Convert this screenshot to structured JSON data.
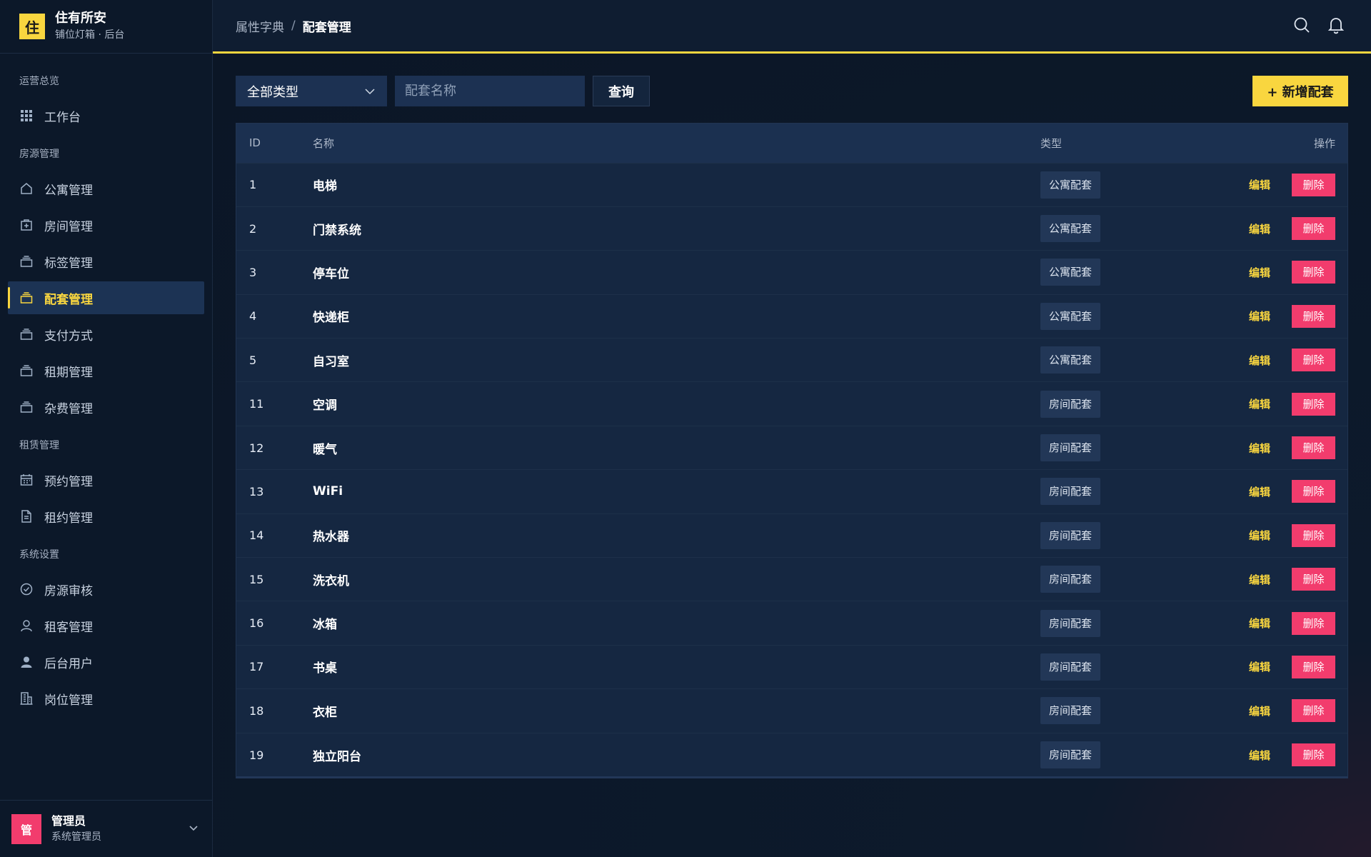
{
  "brand": {
    "logo": "住",
    "title": "住有所安",
    "subtitle": "铺位灯箱 · 后台"
  },
  "colors": {
    "accent": "#f9d63f",
    "danger": "#f23c6d",
    "sidebar_bg": "#0c1829",
    "active_bg": "#1c3354"
  },
  "nav": [
    {
      "title": "运营总览",
      "items": [
        {
          "label": "工作台",
          "icon": "grid-icon"
        }
      ]
    },
    {
      "title": "房源管理",
      "items": [
        {
          "label": "公寓管理",
          "icon": "home-icon"
        },
        {
          "label": "房间管理",
          "icon": "door-icon"
        },
        {
          "label": "标签管理",
          "icon": "layers-icon"
        },
        {
          "label": "配套管理",
          "icon": "layers-icon",
          "active": true
        },
        {
          "label": "支付方式",
          "icon": "layers-icon"
        },
        {
          "label": "租期管理",
          "icon": "layers-icon"
        },
        {
          "label": "杂费管理",
          "icon": "layers-icon"
        }
      ]
    },
    {
      "title": "租赁管理",
      "items": [
        {
          "label": "预约管理",
          "icon": "calendar-icon"
        },
        {
          "label": "租约管理",
          "icon": "document-icon"
        }
      ]
    },
    {
      "title": "系统设置",
      "items": [
        {
          "label": "房源审核",
          "icon": "check-circle-icon"
        },
        {
          "label": "租客管理",
          "icon": "user-icon"
        },
        {
          "label": "后台用户",
          "icon": "user-filled-icon"
        },
        {
          "label": "岗位管理",
          "icon": "building-icon"
        }
      ]
    }
  ],
  "user": {
    "avatar": "管",
    "name": "管理员",
    "role": "系统管理员"
  },
  "breadcrumb": {
    "parent": "属性字典",
    "separator": "/",
    "current": "配套管理"
  },
  "toolbar": {
    "type_select": "全部类型",
    "name_placeholder": "配套名称",
    "query_label": "查询",
    "add_label": "+ 新增配套"
  },
  "table": {
    "headers": {
      "id": "ID",
      "name": "名称",
      "type": "类型",
      "ops": "操作"
    },
    "edit_label": "编辑",
    "delete_label": "删除",
    "rows": [
      {
        "id": "1",
        "name": "电梯",
        "type": "公寓配套"
      },
      {
        "id": "2",
        "name": "门禁系统",
        "type": "公寓配套"
      },
      {
        "id": "3",
        "name": "停车位",
        "type": "公寓配套"
      },
      {
        "id": "4",
        "name": "快递柜",
        "type": "公寓配套"
      },
      {
        "id": "5",
        "name": "自习室",
        "type": "公寓配套"
      },
      {
        "id": "11",
        "name": "空调",
        "type": "房间配套"
      },
      {
        "id": "12",
        "name": "暖气",
        "type": "房间配套"
      },
      {
        "id": "13",
        "name": "WiFi",
        "type": "房间配套"
      },
      {
        "id": "14",
        "name": "热水器",
        "type": "房间配套"
      },
      {
        "id": "15",
        "name": "洗衣机",
        "type": "房间配套"
      },
      {
        "id": "16",
        "name": "冰箱",
        "type": "房间配套"
      },
      {
        "id": "17",
        "name": "书桌",
        "type": "房间配套"
      },
      {
        "id": "18",
        "name": "衣柜",
        "type": "房间配套"
      },
      {
        "id": "19",
        "name": "独立阳台",
        "type": "房间配套"
      }
    ]
  }
}
